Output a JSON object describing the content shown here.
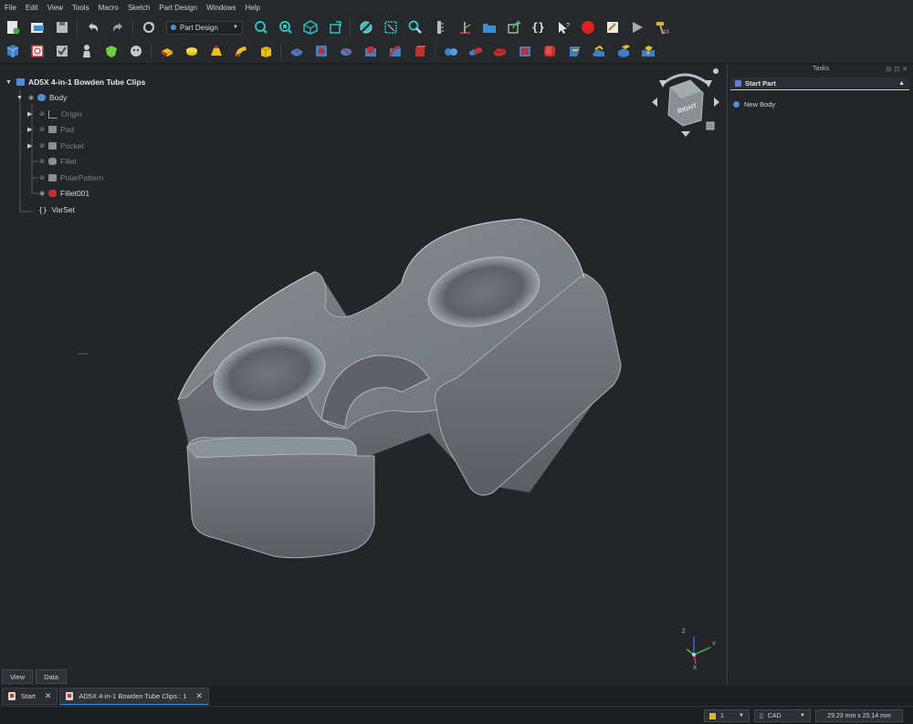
{
  "menu": [
    "File",
    "Edit",
    "View",
    "Tools",
    "Macro",
    "Sketch",
    "Part Design",
    "Windows",
    "Help"
  ],
  "toolbar": {
    "workbench": "Part Design",
    "row1_icons": [
      "new-file-icon",
      "open-file-icon",
      "save-icon",
      "undo-icon",
      "redo-icon",
      "refresh-icon",
      "workbench-selector",
      "fit-all-icon",
      "fit-selection-icon",
      "isometric-view-icon",
      "std-views-icon",
      "draw-style-icon",
      "bounding-box-icon",
      "zoom-icon",
      "measure-icon",
      "axis-cross-icon",
      "folder-icon",
      "export-icon",
      "varset-icon",
      "whats-this-icon",
      "record-macro-icon",
      "macro-editor-icon",
      "run-macro-icon",
      "hammer-icon"
    ],
    "row2_icons": [
      "body-icon",
      "create-sketch-icon",
      "validate-sketch-icon",
      "clone-icon",
      "sub-shape-binder-icon",
      "shape-binder-icon",
      "pad-icon",
      "revolution-icon",
      "loft-icon",
      "pipe-icon",
      "additive-primitive-icon",
      "pocket-icon",
      "hole-icon",
      "groove-icon",
      "subtractive-loft-icon",
      "subtractive-pipe-icon",
      "subtractive-primitive-icon",
      "mirrored-icon",
      "linear-pattern-icon",
      "polar-pattern-icon",
      "multi-transform-icon",
      "fillet-icon",
      "chamfer-icon",
      "draft-icon",
      "thickness-icon"
    ]
  },
  "tree": {
    "document": "AD5X 4-in-1 Bowden Tube Clips",
    "items": [
      {
        "label": "Body",
        "level": 1,
        "dim": false
      },
      {
        "label": "Origin",
        "level": 2,
        "dim": true
      },
      {
        "label": "Pad",
        "level": 2,
        "dim": true
      },
      {
        "label": "Pocket",
        "level": 2,
        "dim": true
      },
      {
        "label": "Fillet",
        "level": 2,
        "dim": true
      },
      {
        "label": "PolarPattern",
        "level": 2,
        "dim": true
      },
      {
        "label": "Fillet001",
        "level": 2,
        "dim": false
      },
      {
        "label": "VarSet",
        "level": 1,
        "dim": false
      }
    ]
  },
  "tasks": {
    "title": "Tasks",
    "panel_title": "Start Part",
    "action": "New Body"
  },
  "navcube": {
    "face": "RIGHT"
  },
  "axis": {
    "x": "X",
    "y": "Y",
    "z": "Z"
  },
  "view_tabs": [
    "View",
    "Data"
  ],
  "doc_tabs": [
    {
      "label": "Start",
      "active": false
    },
    {
      "label": "AD5X 4-in-1 Bowden Tube Clips : 1",
      "active": true
    }
  ],
  "status": {
    "layer": "1",
    "nav_style": "CAD",
    "dimensions": "29.23 mm x 25.14 mm"
  },
  "colors": {
    "background": "#232529",
    "model": "#6f747a",
    "accent": "#4a90d9",
    "record": "#e02020"
  }
}
